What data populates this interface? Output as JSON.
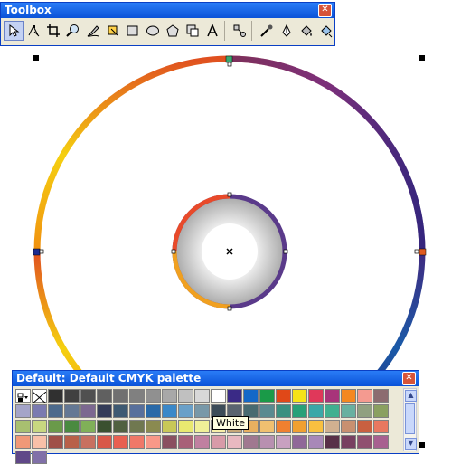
{
  "toolbox": {
    "title": "Toolbox",
    "tools": [
      "pick-tool-icon",
      "shape-tool-icon",
      "crop-tool-icon",
      "zoom-tool-icon",
      "freehand-tool-icon",
      "smart-fill-icon",
      "rectangle-tool-icon",
      "ellipse-tool-icon",
      "polygon-tool-icon",
      "basic-shapes-icon",
      "text-tool-icon",
      "interactive-blend-icon",
      "eyedropper-tool-icon",
      "outline-tool-icon",
      "fill-tool-icon",
      "interactive-fill-icon"
    ]
  },
  "palette": {
    "title": "Default: Default CMYK palette",
    "tooltip": "White",
    "colors": [
      "#303030",
      "#404040",
      "#505050",
      "#606060",
      "#707070",
      "#808080",
      "#909090",
      "#a8a8a8",
      "#c0c0c0",
      "#d8d8d8",
      "#ffffff",
      "#3a2a86",
      "#1468c8",
      "#1a9a48",
      "#e04818",
      "#f5e318",
      "#e0385a",
      "#a8347a",
      "#f48820",
      "#f49a90",
      "#8c6c70",
      "#a4a4c8",
      "#7a7ab0",
      "#4c6a8c",
      "#647894",
      "#7c6890",
      "#343c58",
      "#3e5a72",
      "#58709c",
      "#2a6aa8",
      "#3a88c8",
      "#6aa0c8",
      "#7898a8",
      "#3c4c58",
      "#5a6470",
      "#486a70",
      "#5a8a90",
      "#3a9080",
      "#28a078",
      "#3aa8a8",
      "#40b090",
      "#68b0a0",
      "#90a080",
      "#8aa060",
      "#a8c070",
      "#c8d880",
      "#6a9a4a",
      "#4a8a40",
      "#80b058",
      "#3a5030",
      "#506040",
      "#707850",
      "#8a8a50",
      "#c8c858",
      "#e8e870",
      "#f0f098",
      "#f8f0a8",
      "#c8a878",
      "#e8b060",
      "#f0c070",
      "#f08030",
      "#f0a030",
      "#f8c040",
      "#d0b090",
      "#c89070",
      "#c86040",
      "#e87860",
      "#f09878",
      "#f8c0a8",
      "#a05048",
      "#b86048",
      "#c87060",
      "#d85848",
      "#e86050",
      "#f07868",
      "#f89888",
      "#8a5060",
      "#a86078",
      "#c080a0",
      "#d89aa8",
      "#e8b8c0",
      "#a07890",
      "#b890b0",
      "#c8a0c0",
      "#906898",
      "#a888b8",
      "#583048",
      "#784060",
      "#905070",
      "#a86090",
      "#604888",
      "#8070a8"
    ]
  }
}
